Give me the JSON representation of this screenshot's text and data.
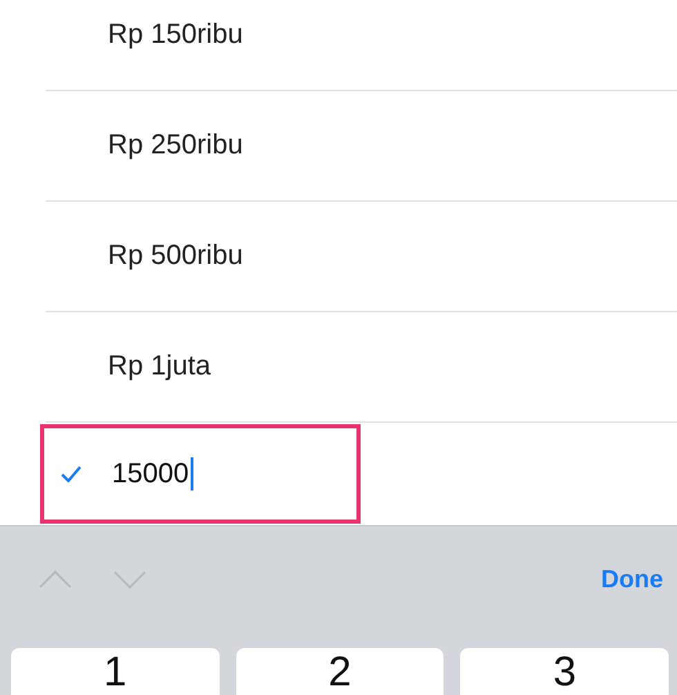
{
  "options": [
    {
      "label": "Rp 150ribu",
      "selected": false
    },
    {
      "label": "Rp 250ribu",
      "selected": false
    },
    {
      "label": "Rp 500ribu",
      "selected": false
    },
    {
      "label": "Rp 1juta",
      "selected": false
    }
  ],
  "custom_amount": {
    "value": "15000",
    "selected": true,
    "highlighted": true
  },
  "keyboard_toolbar": {
    "previous_disabled": true,
    "next_disabled": true,
    "done": "Done"
  },
  "keys": [
    "1",
    "2",
    "3"
  ]
}
